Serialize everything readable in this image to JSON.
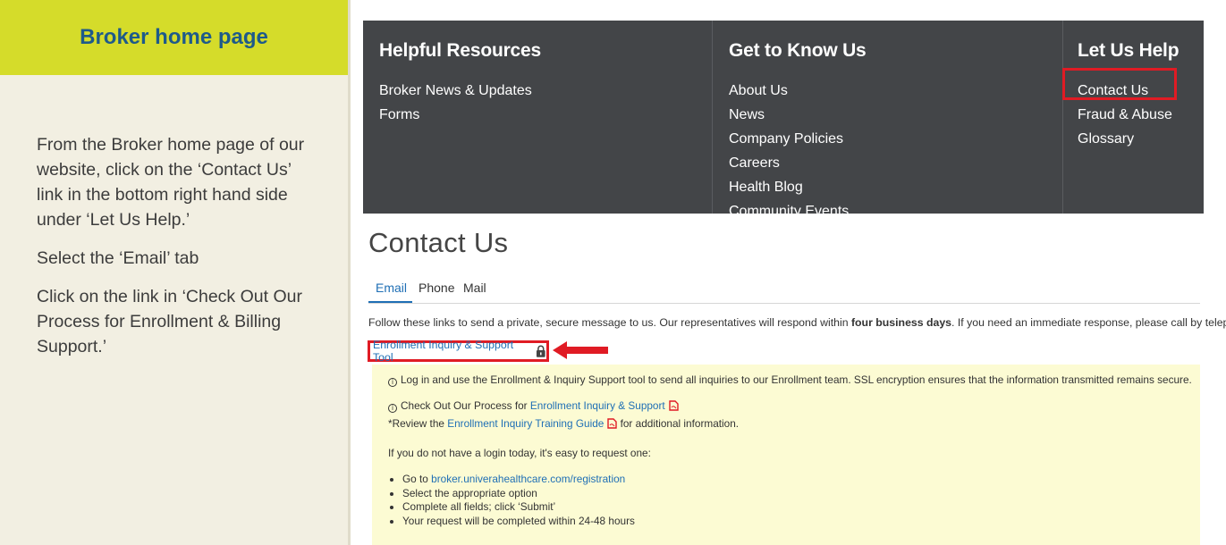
{
  "left": {
    "title": "Broker home page",
    "paragraphs": [
      "From the Broker home page of our website, click on the ‘Contact Us’ link in the bottom right hand side under ‘Let Us Help.’",
      "Select the ‘Email’ tab",
      "Click on the link in ‘Check Out Our Process for Enrollment & Billing Support.’"
    ]
  },
  "footer": {
    "columns": [
      {
        "heading": "Helpful Resources",
        "links": [
          "Broker News & Updates",
          "Forms"
        ]
      },
      {
        "heading": "Get to Know Us",
        "links": [
          "About Us",
          "News",
          "Company Policies",
          "Careers",
          "Health Blog",
          "Community Events"
        ]
      },
      {
        "heading": "Let Us Help",
        "links": [
          "Contact Us",
          "Fraud & Abuse",
          "Glossary"
        ]
      }
    ]
  },
  "contact": {
    "title": "Contact Us",
    "tabs": [
      "Email",
      "Phone",
      "Mail"
    ],
    "intro_pre": "Follow these links to send a private, secure message to us. Our representatives will respond within ",
    "intro_bold": "four business days",
    "intro_post": ". If you need an immediate response, please call by telephone.",
    "tool_link": "Enrollment Inquiry & Support Tool",
    "info_line": "Log in and use the Enrollment & Inquiry Support tool to send all inquiries to our Enrollment team. SSL encryption ensures that the information transmitted remains secure.",
    "process_pre": "Check Out Our Process for ",
    "process_link": "Enrollment Inquiry & Support",
    "review_pre": "*Review the ",
    "review_link": "Enrollment Inquiry Training Guide",
    "review_post": " for additional information.",
    "no_login": "If you do not have a login today, it's easy to request one:",
    "bullet_go_pre": "Go to ",
    "bullet_go_link": "broker.univerahealthcare.com/registration",
    "bullets": [
      "Select the appropriate option",
      "Complete all fields; click ‘Submit’",
      "Your request will be completed within 24-48 hours"
    ]
  },
  "colors": {
    "accent_yellow": "#d5dc2a",
    "title_blue": "#1e5a8a",
    "link_blue": "#1f6fb5",
    "highlight_red": "#e01b24",
    "footer_bg": "#434548",
    "note_bg": "#fcfbd3"
  }
}
